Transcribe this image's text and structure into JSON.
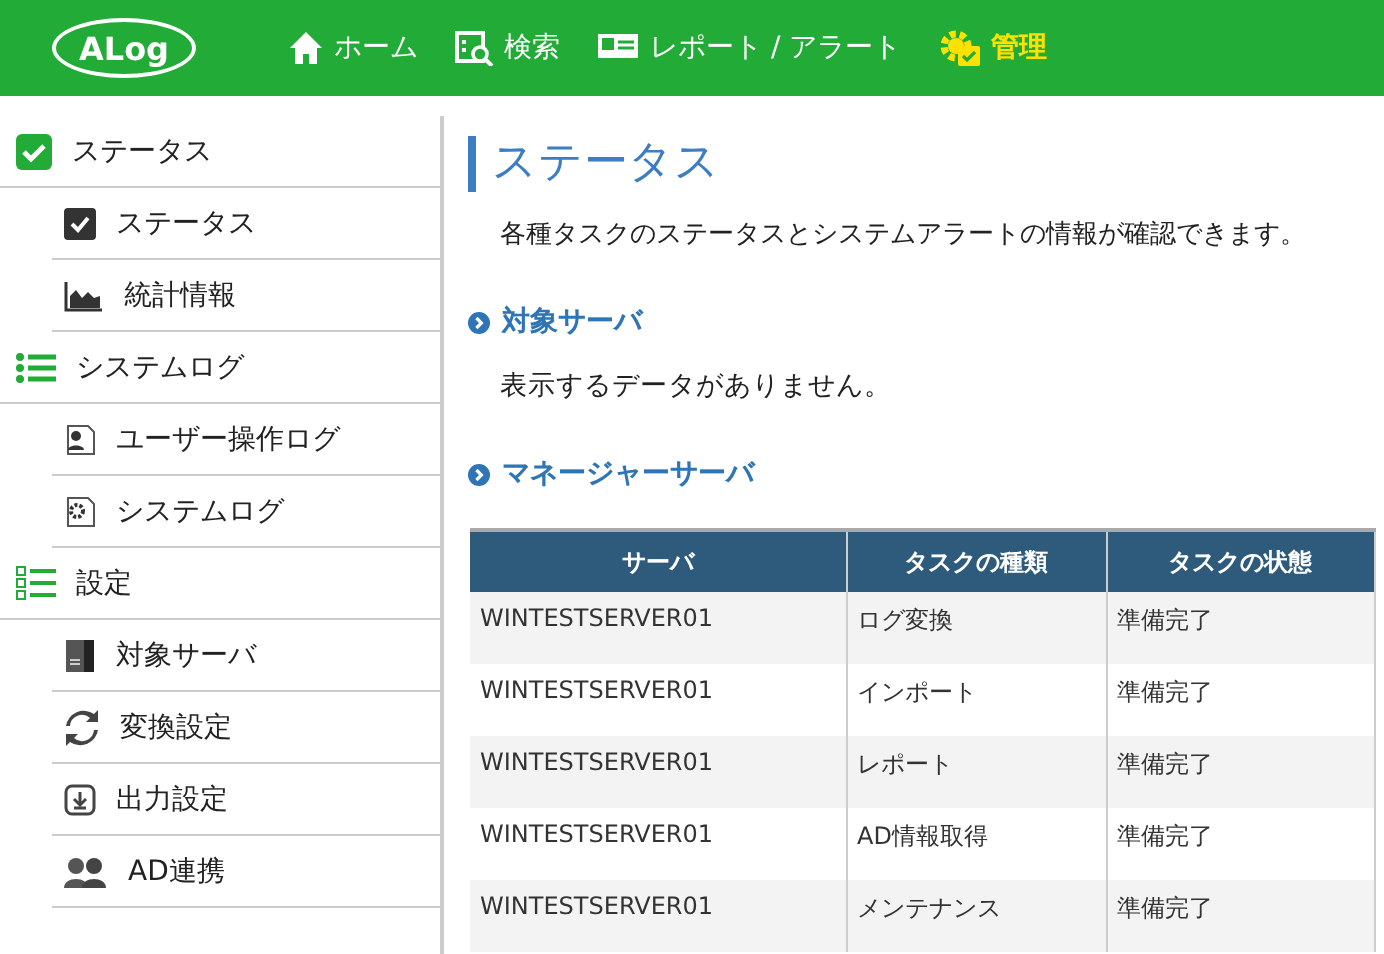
{
  "header": {
    "logo": "ALog",
    "nav": [
      {
        "label": "ホーム",
        "selected": false
      },
      {
        "label": "検索",
        "selected": false
      },
      {
        "label": "レポート / アラート",
        "selected": false
      },
      {
        "label": "管理",
        "selected": true
      }
    ]
  },
  "sidebar": {
    "groups": [
      {
        "label": "ステータス",
        "children": [
          {
            "label": "ステータス"
          },
          {
            "label": "統計情報"
          }
        ]
      },
      {
        "label": "システムログ",
        "children": [
          {
            "label": "ユーザー操作ログ"
          },
          {
            "label": "システムログ"
          }
        ]
      },
      {
        "label": "設定",
        "children": [
          {
            "label": "対象サーバ"
          },
          {
            "label": "変換設定"
          },
          {
            "label": "出力設定"
          },
          {
            "label": "AD連携"
          }
        ]
      }
    ]
  },
  "main": {
    "title": "ステータス",
    "description": "各種タスクのステータスとシステムアラートの情報が確認できます。",
    "sections": [
      {
        "heading": "対象サーバ",
        "message": "表示するデータがありません。"
      },
      {
        "heading": "マネージャーサーバ",
        "table": {
          "columns": [
            "サーバ",
            "タスクの種類",
            "タスクの状態"
          ],
          "rows": [
            [
              "WINTESTSERVER01",
              "ログ変換",
              "準備完了"
            ],
            [
              "WINTESTSERVER01",
              "インポート",
              "準備完了"
            ],
            [
              "WINTESTSERVER01",
              "レポート",
              "準備完了"
            ],
            [
              "WINTESTSERVER01",
              "AD情報取得",
              "準備完了"
            ],
            [
              "WINTESTSERVER01",
              "メンテナンス",
              "準備完了"
            ]
          ]
        }
      }
    ]
  }
}
